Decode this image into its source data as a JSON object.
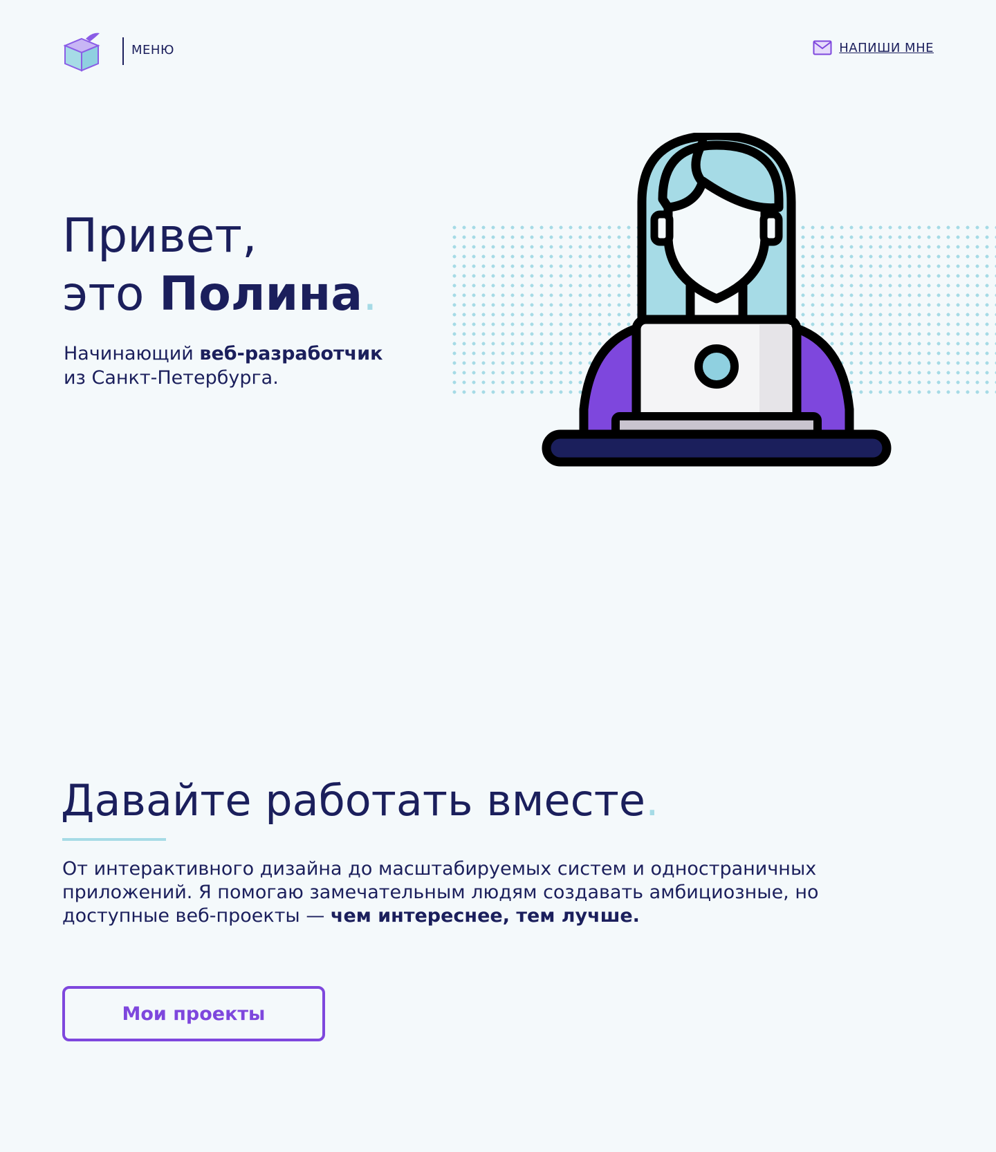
{
  "header": {
    "menu_label": "МЕНЮ",
    "contact_label": "НАПИШИ МНЕ",
    "logo_icon": "cube-logo-icon",
    "contact_icon": "mail-icon"
  },
  "hero": {
    "greeting_line1": "Привет,",
    "greeting_prefix": "это ",
    "name": "Полина",
    "accent_dot": ".",
    "subtitle_part1": "Начинающий ",
    "subtitle_bold": "веб-разработчик",
    "subtitle_line2": "из Санкт-Петербурга.",
    "illustration_icon": "woman-at-laptop-icon"
  },
  "about": {
    "title": "Давайте работать вместе",
    "accent_dot": ".",
    "text_plain": "От интерактивного дизайна до масштабируемых систем и одностраничных приложений. Я помогаю замечательным людям создавать амбициозные, но доступные веб-проекты — ",
    "text_bold": "чем интереснее, тем лучше.",
    "button_label": "Мои проекты"
  },
  "colors": {
    "background": "#f4f9fb",
    "primary_text": "#1b1f5c",
    "accent_light_blue": "#a6dbe6",
    "accent_purple": "#7e47dd"
  }
}
